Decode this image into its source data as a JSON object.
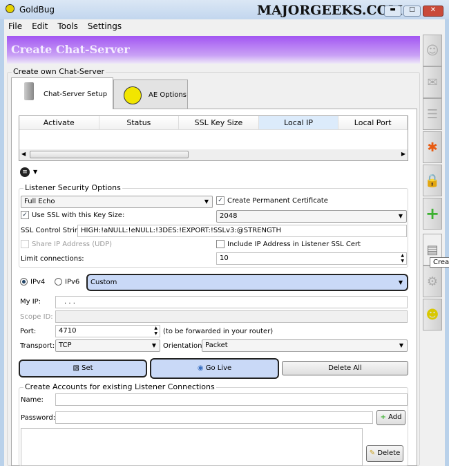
{
  "window": {
    "title": "GoldBug",
    "watermark": "MAJORGEEKS.COM"
  },
  "menu": [
    "File",
    "Edit",
    "Tools",
    "Settings"
  ],
  "header": "Create Chat-Server",
  "group_title": "Create own Chat-Server",
  "tabs": [
    {
      "label": "Chat-Server Setup"
    },
    {
      "label": "AE Options"
    }
  ],
  "table": {
    "columns": [
      "Activate",
      "Status",
      "SSL Key Size",
      "Local IP",
      "Local Port"
    ]
  },
  "security": {
    "title": "Listener Security Options",
    "echo_mode": "Full Echo",
    "create_cert_label": "Create Permanent Certificate",
    "create_cert": true,
    "use_ssl_label": "Use SSL with this Key Size:",
    "use_ssl": true,
    "key_size": "2048",
    "ssl_control_label": "SSL Control String",
    "ssl_control_value": "HIGH:!aNULL:!eNULL:!3DES:!EXPORT:!SSLv3:@STRENGTH",
    "share_ip_label": "Share IP Address (UDP)",
    "include_ip_label": "Include IP Address in Listener SSL Cert",
    "limit_label": "Limit connections:",
    "limit_value": "10"
  },
  "network": {
    "ipv4": "IPv4",
    "ipv6": "IPv6",
    "ip_mode": "Custom",
    "my_ip_label": "My IP:",
    "my_ip_value": ". . .",
    "scope_label": "Scope ID:",
    "port_label": "Port:",
    "port_value": "4710",
    "port_hint": "(to be forwarded in your router)",
    "transport_label": "Transport:",
    "transport_value": "TCP",
    "orientation_label": "Orientation:",
    "orientation_value": "Packet"
  },
  "buttons": {
    "set": "Set",
    "go_live": "Go Live",
    "delete_all": "Delete All"
  },
  "accounts": {
    "title": "Create Accounts for existing Listener Connections",
    "name_label": "Name:",
    "password_label": "Password:",
    "add": "Add",
    "delete": "Delete"
  },
  "tooltip": "Crea"
}
